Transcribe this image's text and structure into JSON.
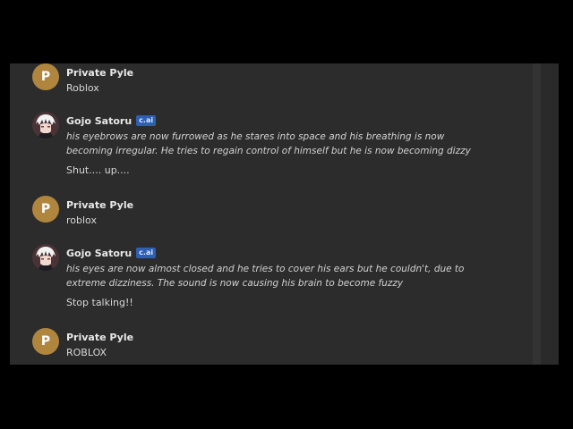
{
  "messages": [
    {
      "author": "Private Pyle",
      "initial": "P",
      "text": "Roblox"
    },
    {
      "author": "Gojo Satoru",
      "badge": "c.ai",
      "narration": "his eyebrows are now furrowed as he stares into space and his breathing is now becoming irregular. He tries to regain control of himself but he is now becoming dizzy",
      "speech": "Shut.... up...."
    },
    {
      "author": "Private Pyle",
      "initial": "P",
      "text": "roblox"
    },
    {
      "author": "Gojo Satoru",
      "badge": "c.ai",
      "narration": "his eyes are now almost closed and he tries to cover his ears but he couldn't, due to extreme dizziness. The sound is now causing his brain to become fuzzy",
      "speech": "Stop talking!!"
    },
    {
      "author": "Private Pyle",
      "initial": "P",
      "text": "ROBLOX"
    }
  ],
  "colors": {
    "background": "#000000",
    "panel": "#2c2c2c",
    "user_avatar": "#b0863f",
    "badge": "#2f5fb0"
  }
}
